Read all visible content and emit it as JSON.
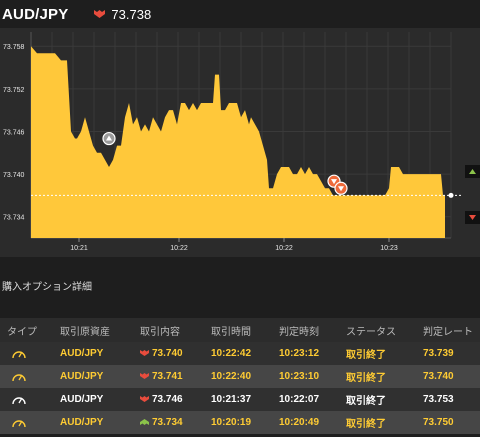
{
  "header": {
    "pair": "AUD/JPY",
    "rate": "73.738",
    "arrow": "down-arrow-icon",
    "down_color": "#e84c3d",
    "up_color": "#8bc34a"
  },
  "chart_data": {
    "type": "area",
    "title": "",
    "xlabel": "",
    "ylabel": "",
    "ylim": [
      73.731,
      73.76
    ],
    "xlim": [
      0,
      420
    ],
    "yticks": [
      "73.758",
      "73.752",
      "73.746",
      "73.740",
      "73.734"
    ],
    "xticks": [
      {
        "t": 48,
        "label": "10:21"
      },
      {
        "t": 148,
        "label": "10:22"
      },
      {
        "t": 253,
        "label": "10:22"
      },
      {
        "t": 358,
        "label": "10:23"
      }
    ],
    "grid": true,
    "area_color": "#ffc83a",
    "current_rate": 73.737,
    "points": [
      [
        0,
        73.758
      ],
      [
        6,
        73.757
      ],
      [
        12,
        73.757
      ],
      [
        18,
        73.757
      ],
      [
        24,
        73.757
      ],
      [
        30,
        73.756
      ],
      [
        36,
        73.756
      ],
      [
        40,
        73.746
      ],
      [
        44,
        73.745
      ],
      [
        46,
        73.745
      ],
      [
        50,
        73.746
      ],
      [
        54,
        73.748
      ],
      [
        58,
        73.746
      ],
      [
        62,
        73.744
      ],
      [
        66,
        73.743
      ],
      [
        70,
        73.743
      ],
      [
        74,
        73.742
      ],
      [
        78,
        73.741
      ],
      [
        82,
        73.742
      ],
      [
        86,
        73.744
      ],
      [
        90,
        73.744
      ],
      [
        94,
        73.748
      ],
      [
        98,
        73.75
      ],
      [
        102,
        73.747
      ],
      [
        106,
        73.748
      ],
      [
        110,
        73.746
      ],
      [
        114,
        73.747
      ],
      [
        118,
        73.746
      ],
      [
        122,
        73.748
      ],
      [
        126,
        73.747
      ],
      [
        130,
        73.746
      ],
      [
        134,
        73.748
      ],
      [
        138,
        73.749
      ],
      [
        142,
        73.749
      ],
      [
        146,
        73.747
      ],
      [
        150,
        73.75
      ],
      [
        154,
        73.75
      ],
      [
        158,
        73.749
      ],
      [
        162,
        73.75
      ],
      [
        166,
        73.749
      ],
      [
        170,
        73.75
      ],
      [
        174,
        73.75
      ],
      [
        178,
        73.75
      ],
      [
        182,
        73.75
      ],
      [
        184,
        73.754
      ],
      [
        188,
        73.754
      ],
      [
        190,
        73.749
      ],
      [
        194,
        73.749
      ],
      [
        198,
        73.75
      ],
      [
        202,
        73.75
      ],
      [
        206,
        73.75
      ],
      [
        210,
        73.748
      ],
      [
        214,
        73.749
      ],
      [
        218,
        73.747
      ],
      [
        220,
        73.748
      ],
      [
        224,
        73.747
      ],
      [
        228,
        73.746
      ],
      [
        232,
        73.744
      ],
      [
        236,
        73.742
      ],
      [
        238,
        73.738
      ],
      [
        242,
        73.738
      ],
      [
        246,
        73.74
      ],
      [
        250,
        73.741
      ],
      [
        254,
        73.741
      ],
      [
        258,
        73.741
      ],
      [
        262,
        73.74
      ],
      [
        266,
        73.74
      ],
      [
        270,
        73.741
      ],
      [
        274,
        73.74
      ],
      [
        278,
        73.741
      ],
      [
        282,
        73.74
      ],
      [
        286,
        73.74
      ],
      [
        290,
        73.739
      ],
      [
        294,
        73.738
      ],
      [
        298,
        73.738
      ],
      [
        302,
        73.737
      ],
      [
        306,
        73.737
      ],
      [
        310,
        73.737
      ],
      [
        314,
        73.737
      ],
      [
        320,
        73.737
      ],
      [
        326,
        73.737
      ],
      [
        332,
        73.737
      ],
      [
        338,
        73.737
      ],
      [
        344,
        73.737
      ],
      [
        350,
        73.737
      ],
      [
        354,
        73.737
      ],
      [
        358,
        73.738
      ],
      [
        360,
        73.741
      ],
      [
        364,
        73.741
      ],
      [
        368,
        73.741
      ],
      [
        372,
        73.74
      ],
      [
        376,
        73.74
      ],
      [
        380,
        73.74
      ],
      [
        386,
        73.74
      ],
      [
        392,
        73.74
      ],
      [
        398,
        73.74
      ],
      [
        402,
        73.74
      ],
      [
        406,
        73.74
      ],
      [
        410,
        73.74
      ],
      [
        412,
        73.737
      ],
      [
        414,
        73.737
      ]
    ],
    "markers": [
      {
        "t": 78,
        "rate": 73.745,
        "dir": "up",
        "color": "#9a9a9a"
      },
      {
        "t": 303,
        "rate": 73.739,
        "dir": "down",
        "color": "#ee6a3a"
      },
      {
        "t": 310,
        "rate": 73.738,
        "dir": "down",
        "color": "#ee6a3a"
      }
    ],
    "right_icons": [
      "up",
      "down"
    ]
  },
  "section": {
    "title": "購入オプション詳細"
  },
  "table": {
    "headers": [
      "タイプ",
      "取引原資産",
      "取引内容",
      "取引時間",
      "判定時刻",
      "ステータス",
      "判定レート"
    ],
    "rows": [
      {
        "icon": "gauge-icon",
        "icon_color": "#ffcc33",
        "asset": "AUD/JPY",
        "dir": "down",
        "rate": "73.740",
        "time": "10:22:42",
        "judge": "10:23:12",
        "status": "取引終了",
        "judge_rate": "73.739",
        "text_color": "#ffcc33"
      },
      {
        "icon": "gauge-icon",
        "icon_color": "#ffcc33",
        "asset": "AUD/JPY",
        "dir": "down",
        "rate": "73.741",
        "time": "10:22:40",
        "judge": "10:23:10",
        "status": "取引終了",
        "judge_rate": "73.740",
        "text_color": "#ffcc33"
      },
      {
        "icon": "gauge-icon",
        "icon_color": "#ffffff",
        "asset": "AUD/JPY",
        "dir": "down",
        "rate": "73.746",
        "time": "10:21:37",
        "judge": "10:22:07",
        "status": "取引終了",
        "judge_rate": "73.753",
        "text_color": "#ffffff"
      },
      {
        "icon": "gauge-icon",
        "icon_color": "#ffcc33",
        "asset": "AUD/JPY",
        "dir": "up",
        "rate": "73.734",
        "time": "10:20:19",
        "judge": "10:20:49",
        "status": "取引終了",
        "judge_rate": "73.750",
        "text_color": "#ffcc33"
      }
    ]
  }
}
